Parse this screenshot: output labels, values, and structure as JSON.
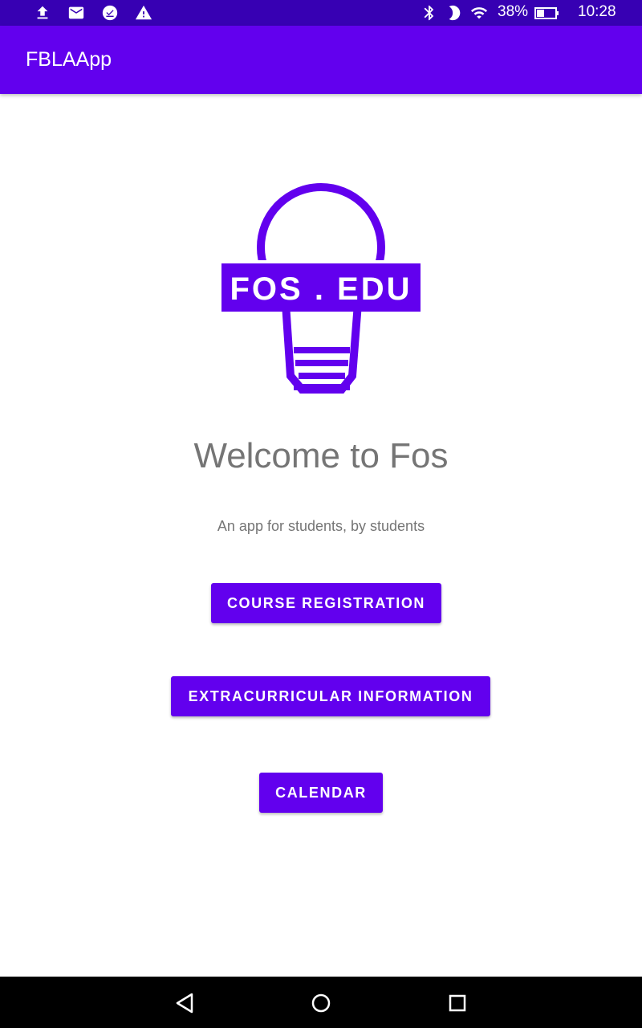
{
  "status_bar": {
    "battery": "38%",
    "time": "10:28",
    "icons": [
      "upload-icon",
      "mail-icon",
      "download-done-icon",
      "warning-icon",
      "bluetooth-icon",
      "moon-icon",
      "wifi-icon",
      "battery-icon"
    ]
  },
  "app_bar": {
    "title": "FBLAApp"
  },
  "logo": {
    "text": "FOS . EDU",
    "color": "#6200ee"
  },
  "main": {
    "welcome": "Welcome to Fos",
    "subtitle": "An app for students, by students",
    "buttons": {
      "course": "COURSE REGISTRATION",
      "extra": "EXTRACURRICULAR INFORMATION",
      "calendar": "CALENDAR"
    }
  },
  "nav_bar": {
    "icons": [
      "back-icon",
      "home-icon",
      "recents-icon"
    ]
  },
  "colors": {
    "primary": "#6200ee",
    "primary_dark": "#3700b3",
    "text_gray": "#757575"
  }
}
